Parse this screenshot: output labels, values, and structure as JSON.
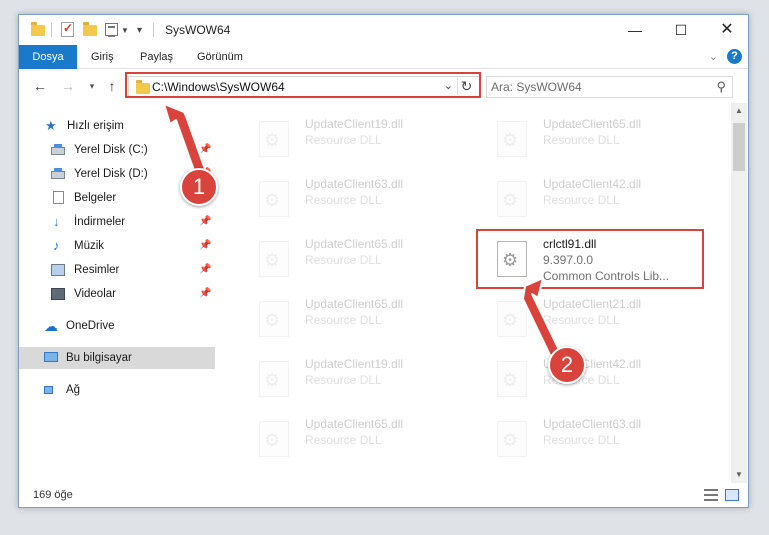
{
  "window": {
    "title": "SysWOW64"
  },
  "ribbon": {
    "tabs": [
      {
        "label": "Dosya"
      },
      {
        "label": "Giriş"
      },
      {
        "label": "Paylaş"
      },
      {
        "label": "Görünüm"
      }
    ]
  },
  "address": {
    "path": "C:\\Windows\\SysWOW64"
  },
  "search": {
    "placeholder": "Ara: SysWOW64"
  },
  "nav": {
    "items": [
      {
        "label": "Hızlı erişim",
        "icon": "star-icon"
      },
      {
        "label": "Yerel Disk (C:)",
        "icon": "drive-icon",
        "pinned": true
      },
      {
        "label": "Yerel Disk (D:)",
        "icon": "drive-icon",
        "pinned": true
      },
      {
        "label": "Belgeler",
        "icon": "documents-icon",
        "pinned": true
      },
      {
        "label": "İndirmeler",
        "icon": "downloads-icon",
        "pinned": true
      },
      {
        "label": "Müzik",
        "icon": "music-icon",
        "pinned": true
      },
      {
        "label": "Resimler",
        "icon": "pictures-icon",
        "pinned": true
      },
      {
        "label": "Videolar",
        "icon": "videos-icon",
        "pinned": true
      },
      {
        "label": "OneDrive",
        "icon": "onedrive-icon"
      },
      {
        "label": "Bu bilgisayar",
        "icon": "computer-icon",
        "selected": true
      },
      {
        "label": "Ağ",
        "icon": "network-icon"
      }
    ]
  },
  "files": {
    "left": [
      {
        "name": "UpdateClient19.dll",
        "desc": "Resource DLL"
      },
      {
        "name": "UpdateClient63.dll",
        "desc": "Resource DLL"
      },
      {
        "name": "UpdateClient65.dll",
        "desc": "Resource DLL"
      },
      {
        "name": "UpdateClient65.dll",
        "desc": "Resource DLL"
      },
      {
        "name": "UpdateClient19.dll",
        "desc": "Resource DLL"
      },
      {
        "name": "UpdateClient65.dll",
        "desc": "Resource DLL"
      }
    ],
    "right": [
      {
        "name": "UpdateClient65.dll",
        "desc": "Resource DLL"
      },
      {
        "name": "UpdateClient42.dll",
        "desc": "Resource DLL"
      },
      {
        "name": "crlctl91.dll",
        "desc": "9.397.0.0",
        "desc2": "Common Controls Lib..."
      },
      {
        "name": "UpdateClient21.dll",
        "desc": "Resource DLL"
      },
      {
        "name": "UpdateClient42.dll",
        "desc": "Resource DLL"
      },
      {
        "name": "UpdateClient63.dll",
        "desc": "Resource DLL"
      }
    ]
  },
  "status": {
    "count": "169 öğe"
  },
  "annotations": [
    {
      "label": "1"
    },
    {
      "label": "2"
    }
  ],
  "colors": {
    "accent": "#1979ca",
    "annotation": "#d9433b",
    "selection": "#d9d9d9"
  }
}
